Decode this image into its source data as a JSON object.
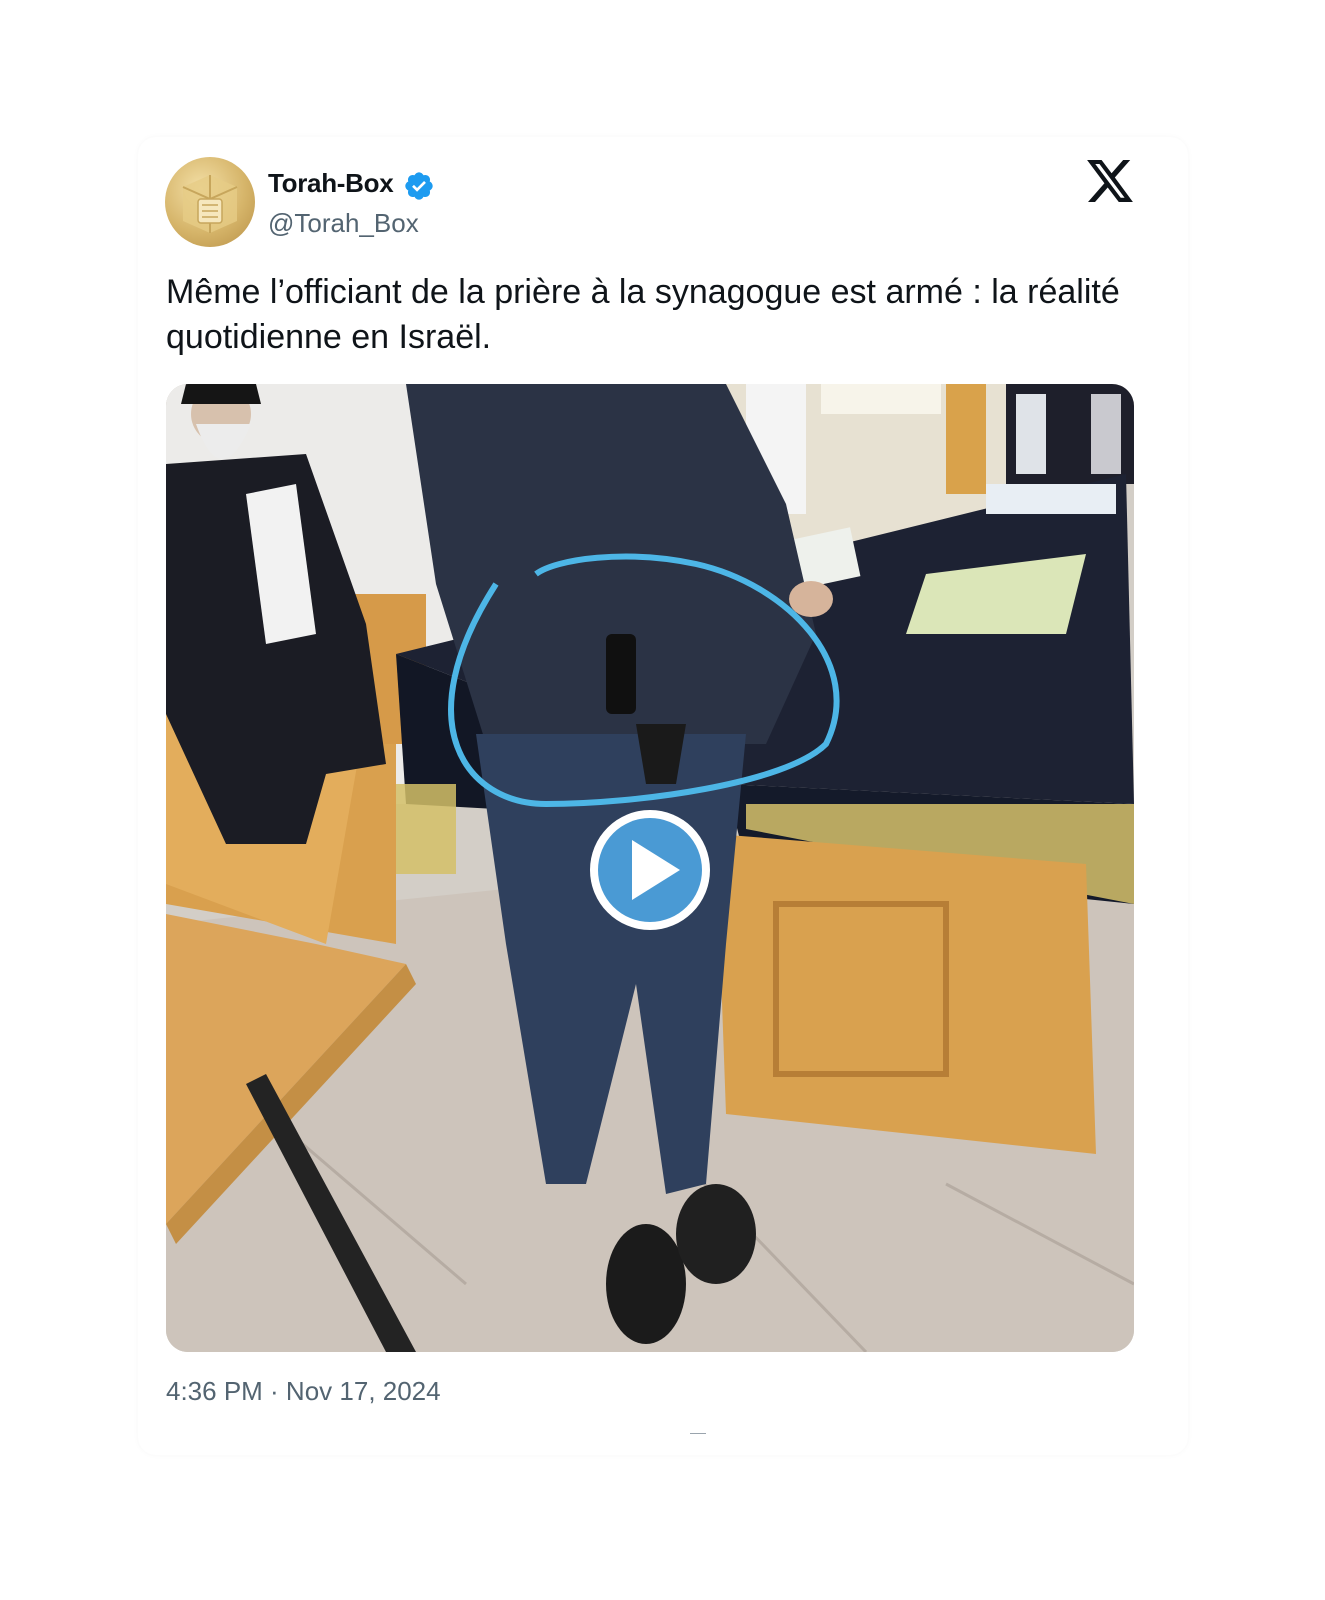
{
  "tweet": {
    "author_name": "Torah-Box",
    "author_handle": "@Torah_Box",
    "verified": true,
    "text": "Même l’officiant de la prière à la synagogue est armé : la réalité quotidienne en Israël.",
    "timestamp": "4:36 PM · Nov 17, 2024"
  },
  "media": {
    "type": "video",
    "play_icon": "play-icon",
    "annotation_color": "#4db6e6"
  },
  "icons": {
    "platform_logo": "x-logo-icon",
    "verified_badge": "verified-badge-icon"
  },
  "colors": {
    "text_primary": "#0f1419",
    "text_secondary": "#536471",
    "verified_blue": "#1d9bf0",
    "play_button": "#4a9ad4"
  }
}
